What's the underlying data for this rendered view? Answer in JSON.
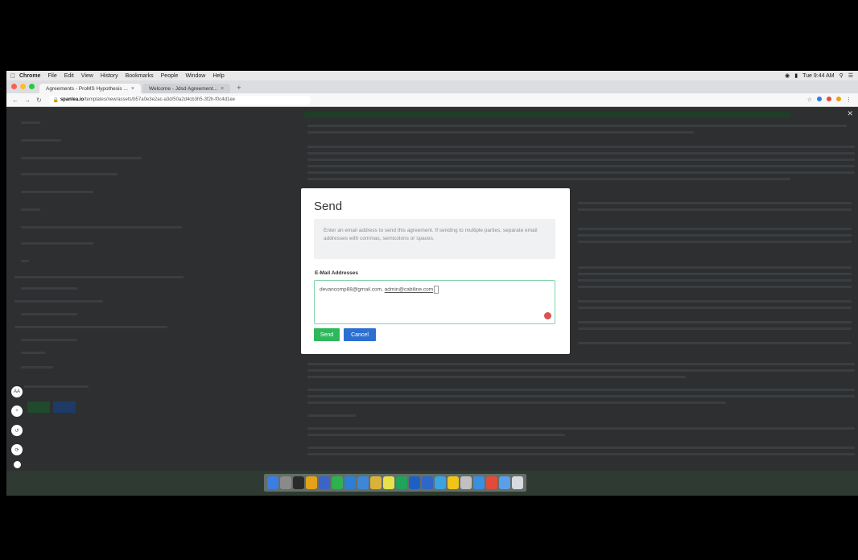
{
  "menubar": {
    "app": "Chrome",
    "items": [
      "File",
      "Edit",
      "View",
      "History",
      "Bookmarks",
      "People",
      "Window",
      "Help"
    ],
    "clock": "Tue 9:44 AM"
  },
  "browser": {
    "tabs": [
      {
        "title": "Agreements - ProMS Hypothesis ..."
      },
      {
        "title": "Welcome - Jdsd Agreement..."
      }
    ],
    "url_host": "spanlea.io",
    "url_path": "/templates/new/assets/b57a0e3e2ac-a3d/50a2d4cb3h5-3f2h-f0c4d1ee"
  },
  "modal": {
    "title": "Send",
    "description": "Enter an email address to send this agreement. If sending to multiple parties, separate email addresses with commas, semicolons or spaces.",
    "field_label": "E-Mail Addresses",
    "email_1": "devancomp88@gmail.com,",
    "email_2": "admin@cabiline.com",
    "send_label": "Send",
    "cancel_label": "Cancel"
  },
  "side_buttons": [
    "AA",
    "+",
    "↺",
    "⟳"
  ],
  "colors": {
    "send": "#2db85c",
    "cancel": "#2d6fd1",
    "field_border": "#7fd5a8",
    "page_bg": "#2d2f31"
  }
}
